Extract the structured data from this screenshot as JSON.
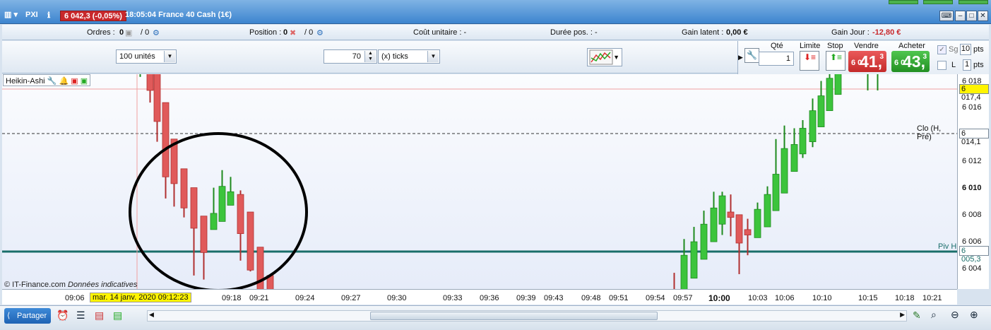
{
  "titlebar": {
    "prefix": "PXI",
    "instrument_quote": "6 042,3 (-0,05%)",
    "time_and_name": "18:05:04 France 40 Cash (1€)"
  },
  "infobar": {
    "orders_label": "Ordres :",
    "orders_value": "0",
    "orders_extra": "/ 0",
    "position_label": "Position :",
    "position_value": "0",
    "position_extra": "/ 0",
    "unit_cost": "Coût unitaire : -",
    "duration": "Durée pos. : -",
    "latent_label": "Gain latent :",
    "latent_value": "0,00 €",
    "day_label": "Gain Jour :",
    "day_value": "-12,80 €",
    "day_color": "#c8282c"
  },
  "toolbar": {
    "units_select": "100 unités",
    "ticks_value": "70",
    "ticks_select": "(x) ticks"
  },
  "order_panel": {
    "qty_label": "Qté",
    "qty_value": "1",
    "limit_label": "Limite",
    "stop_label": "Stop",
    "sell_label": "Vendre",
    "buy_label": "Acheter",
    "sell_small": "6 0",
    "sell_big": "41,",
    "sell_sup": "3",
    "buy_small": "6 0",
    "buy_big": "43,",
    "buy_sup": "3",
    "sell_color": "#d93b3b",
    "buy_color": "#2fa52f",
    "sg_label": "Sg",
    "sg_pts_value": "10",
    "pts_label": "pts",
    "l_label": "L",
    "l_pts_value": "1"
  },
  "chart": {
    "legend": "Heikin-Ashi",
    "watermark_a": "© IT-Finance.com",
    "watermark_b": "Données indicatives",
    "cursor_date": "mar. 14 janv. 2020 09:12:23",
    "clo_label": "Clo (H, Pré)",
    "piv_label": "Piv H",
    "up_color": "#3cc43c",
    "down_color": "#e05a5a"
  },
  "chart_data": {
    "type": "candlestick",
    "y_ticks": [
      "6 018",
      "6 016",
      "6 014,1",
      "6 012",
      "6 010",
      "6 008",
      "6 006",
      "6 004"
    ],
    "y_highlight_labels": {
      "current": "6 017,4",
      "clo": "6 014,1",
      "piv": "6 005,3"
    },
    "x_ticks": [
      "09:06",
      "09:18",
      "09:21",
      "09:24",
      "09:27",
      "09:30",
      "09:33",
      "09:36",
      "09:39",
      "09:43",
      "09:48",
      "09:51",
      "09:54",
      "09:57",
      "10:00",
      "10:03",
      "10:06",
      "10:10",
      "10:15",
      "10:18",
      "10:21"
    ],
    "ylim": [
      6002.9,
      6018.8
    ],
    "candles": [
      {
        "o": 6019.0,
        "c": 6019.0,
        "h": 6019.2,
        "l": 6018.6
      },
      {
        "o": 6019.0,
        "c": 6017.6,
        "h": 6019.0,
        "l": 6016.7
      },
      {
        "o": 6019.0,
        "c": 6015.3,
        "h": 6019.0,
        "l": 6013.8
      },
      {
        "o": 6016.7,
        "c": 6011.2,
        "h": 6016.7,
        "l": 6009.6
      },
      {
        "o": 6014.0,
        "c": 6010.7,
        "h": 6014.0,
        "l": 6009.0
      },
      {
        "o": 6011.8,
        "c": 6008.9,
        "h": 6011.8,
        "l": 6008.2
      },
      {
        "o": 6010.4,
        "c": 6007.4,
        "h": 6010.4,
        "l": 6003.9
      },
      {
        "o": 6008.3,
        "c": 6005.6,
        "h": 6008.3,
        "l": 6003.6
      },
      {
        "o": 6007.3,
        "c": 6008.5,
        "h": 6010.4,
        "l": 6007.3
      },
      {
        "o": 6007.9,
        "c": 6010.5,
        "h": 6011.7,
        "l": 6007.9
      },
      {
        "o": 6009.1,
        "c": 6010.1,
        "h": 6011.2,
        "l": 6009.1
      },
      {
        "o": 6009.9,
        "c": 6007.0,
        "h": 6010.2,
        "l": 6005.0
      },
      {
        "o": 6008.6,
        "c": 6004.3,
        "h": 6008.6,
        "l": 6004.2
      },
      {
        "o": 6006.0,
        "c": 6002.0,
        "h": 6006.0,
        "l": 6002.0
      },
      {
        "o": 6003.9,
        "c": 6002.0,
        "h": 6003.9,
        "l": 6002.0
      },
      {
        "o": 6002.2,
        "c": 6002.0,
        "h": 6004.1,
        "l": 6002.0
      },
      {
        "o": 6002.0,
        "c": 6005.4,
        "h": 6006.6,
        "l": 6002.0
      },
      {
        "o": 6003.7,
        "c": 6006.4,
        "h": 6007.5,
        "l": 6003.7
      },
      {
        "o": 6005.1,
        "c": 6007.7,
        "h": 6008.7,
        "l": 6005.1
      },
      {
        "o": 6006.4,
        "c": 6008.9,
        "h": 6010.1,
        "l": 6006.4
      },
      {
        "o": 6007.7,
        "c": 6009.8,
        "h": 6010.1,
        "l": 6006.9
      },
      {
        "o": 6008.6,
        "c": 6008.2,
        "h": 6009.9,
        "l": 6006.8
      },
      {
        "o": 6008.4,
        "c": 6006.3,
        "h": 6008.4,
        "l": 6004.0
      },
      {
        "o": 6007.3,
        "c": 6006.9,
        "h": 6008.1,
        "l": 6005.4
      },
      {
        "o": 6006.7,
        "c": 6008.8,
        "h": 6009.3,
        "l": 6006.7
      },
      {
        "o": 6007.5,
        "c": 6009.9,
        "h": 6010.5,
        "l": 6007.5
      },
      {
        "o": 6008.7,
        "c": 6011.4,
        "h": 6014.0,
        "l": 6008.7
      },
      {
        "o": 6010.0,
        "c": 6013.3,
        "h": 6015.0,
        "l": 6010.0
      },
      {
        "o": 6011.6,
        "c": 6013.6,
        "h": 6014.8,
        "l": 6011.6
      },
      {
        "o": 6012.9,
        "c": 6014.8,
        "h": 6015.4,
        "l": 6012.6
      },
      {
        "o": 6013.8,
        "c": 6016.1,
        "h": 6017.0,
        "l": 6013.4
      },
      {
        "o": 6014.9,
        "c": 6017.2,
        "h": 6018.3,
        "l": 6014.9
      },
      {
        "o": 6016.1,
        "c": 6018.5,
        "h": 6019.3,
        "l": 6016.1
      },
      {
        "o": 6017.3,
        "c": 6019.2,
        "h": 6019.4,
        "l": 6017.3
      },
      {
        "o": 6019.2,
        "c": 6019.2,
        "h": 6019.2,
        "l": 6017.6
      },
      {
        "o": 6019.2,
        "c": 6019.2,
        "h": 6019.2,
        "l": 6017.6
      }
    ]
  },
  "bottombar": {
    "share_label": "Partager"
  }
}
